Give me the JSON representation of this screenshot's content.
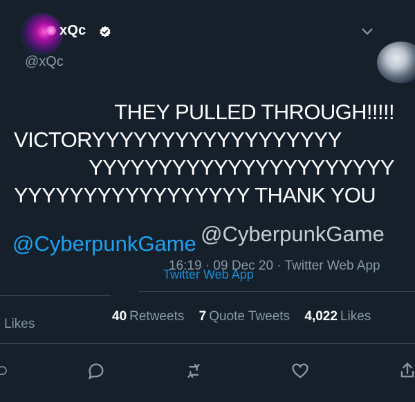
{
  "header": {
    "display_name": "xQc",
    "handle": "@xQc"
  },
  "tweet": {
    "lines": [
      "THEY PULLED THROUGH!!!!!",
      "VICTORYYYYYYYYYYYYYYYYYY",
      "YYYYYYYYYYYYYYYYYYYYYY",
      "YYYYYYYYYYYYYYYYY THANK YOU",
      "@CyberpunkGame"
    ],
    "timestamp": "16:19 · 09 Dec 20 · Twitter Web App",
    "app": "Twitter Web App"
  },
  "stats": {
    "retweets_count": "40",
    "retweets_label": "Retweets",
    "quote_count": "7",
    "quote_label": "Quote Tweets",
    "likes_count": "4,022",
    "likes_label": "Likes"
  },
  "colors": {
    "background": "#15202b",
    "accent": "#1da1f2",
    "secondary_text": "#8899a6",
    "divider": "#38444d"
  },
  "icons": {
    "more": "chevron-down-icon",
    "reply": "reply-icon",
    "retweet": "retweet-icon",
    "like": "heart-icon",
    "share": "share-icon"
  }
}
